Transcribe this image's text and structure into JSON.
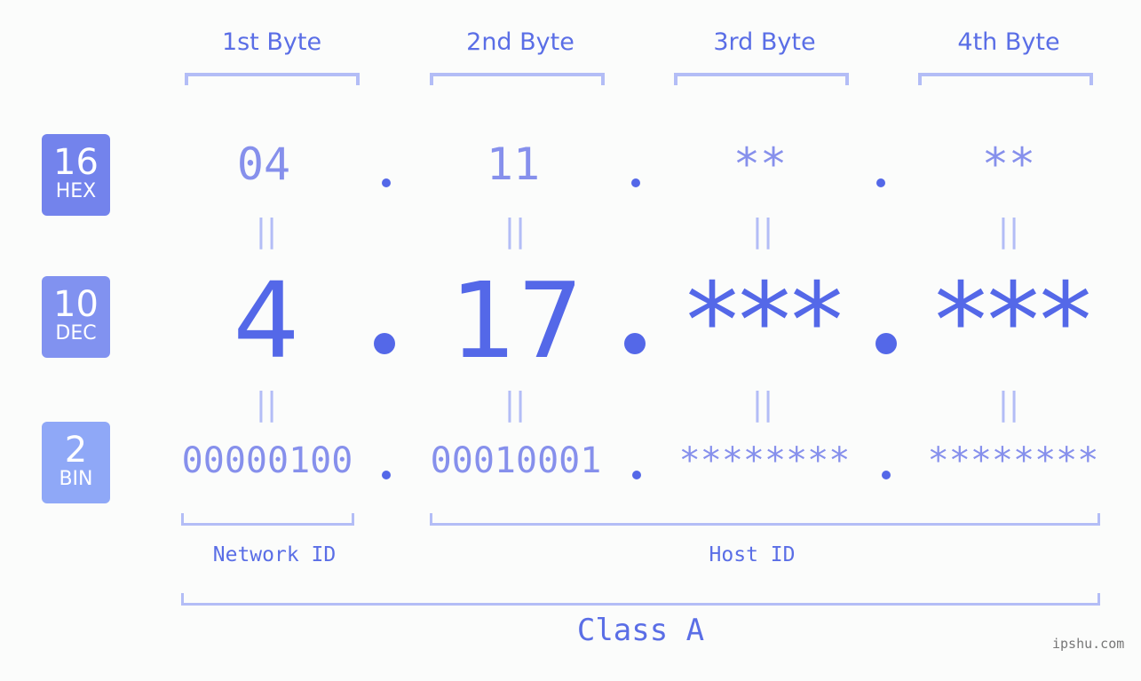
{
  "bases": [
    {
      "num": "16",
      "label": "HEX",
      "color": "#7383ec"
    },
    {
      "num": "10",
      "label": "DEC",
      "color": "#8192f0"
    },
    {
      "num": "2",
      "label": "BIN",
      "color": "#8fa8f7"
    }
  ],
  "bytes": [
    {
      "header": "1st Byte",
      "hex": "04",
      "dec": "4",
      "bin": "00000100"
    },
    {
      "header": "2nd Byte",
      "hex": "11",
      "dec": "17",
      "bin": "00010001"
    },
    {
      "header": "3rd Byte",
      "hex": "**",
      "dec": "***",
      "bin": "********"
    },
    {
      "header": "4th Byte",
      "hex": "**",
      "dec": "***",
      "bin": "********"
    }
  ],
  "equals_glyph": "||",
  "network_id_label": "Network ID",
  "host_id_label": "Host ID",
  "class_label": "Class A",
  "watermark": "ipshu.com"
}
